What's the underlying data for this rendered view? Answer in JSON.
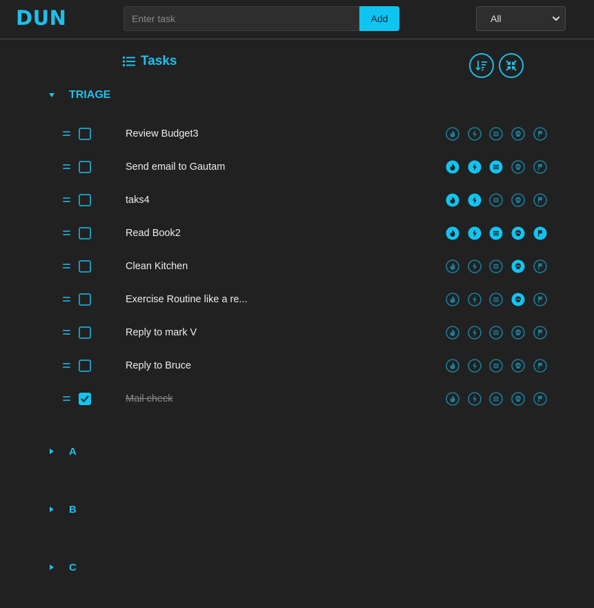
{
  "app": {
    "logo": "DUN"
  },
  "header": {
    "task_placeholder": "Enter task",
    "add_label": "Add",
    "filter_value": "All"
  },
  "section": {
    "title": "Tasks"
  },
  "colors": {
    "accent": "#10c4f2",
    "background": "#212121",
    "icon_inactive": "#1a7f9a"
  },
  "groups": [
    {
      "name": "TRIAGE",
      "expanded": true,
      "tasks": [
        {
          "text": "Review Budget3",
          "done": false,
          "flags": [
            false,
            false,
            false,
            false,
            false
          ]
        },
        {
          "text": "Send email to Gautam",
          "done": false,
          "flags": [
            true,
            true,
            true,
            false,
            false
          ]
        },
        {
          "text": "taks4",
          "done": false,
          "flags": [
            true,
            true,
            false,
            false,
            false
          ]
        },
        {
          "text": "Read Book2",
          "done": false,
          "flags": [
            true,
            true,
            true,
            true,
            true
          ]
        },
        {
          "text": "Clean Kitchen",
          "done": false,
          "flags": [
            false,
            false,
            false,
            true,
            false
          ]
        },
        {
          "text": "Exercise Routine like a re...",
          "done": false,
          "flags": [
            false,
            false,
            false,
            true,
            false
          ]
        },
        {
          "text": "Reply to mark V",
          "done": false,
          "flags": [
            false,
            false,
            false,
            false,
            false
          ]
        },
        {
          "text": "Reply to Bruce",
          "done": false,
          "flags": [
            false,
            false,
            false,
            false,
            false
          ]
        },
        {
          "text": "Mail check",
          "done": true,
          "flags": [
            false,
            false,
            false,
            false,
            false
          ]
        }
      ]
    },
    {
      "name": "A",
      "expanded": false
    },
    {
      "name": "B",
      "expanded": false
    },
    {
      "name": "C",
      "expanded": false
    }
  ],
  "flag_icons": [
    "fire-icon",
    "bolt-icon",
    "list-icon",
    "skull-icon",
    "flag-icon"
  ]
}
